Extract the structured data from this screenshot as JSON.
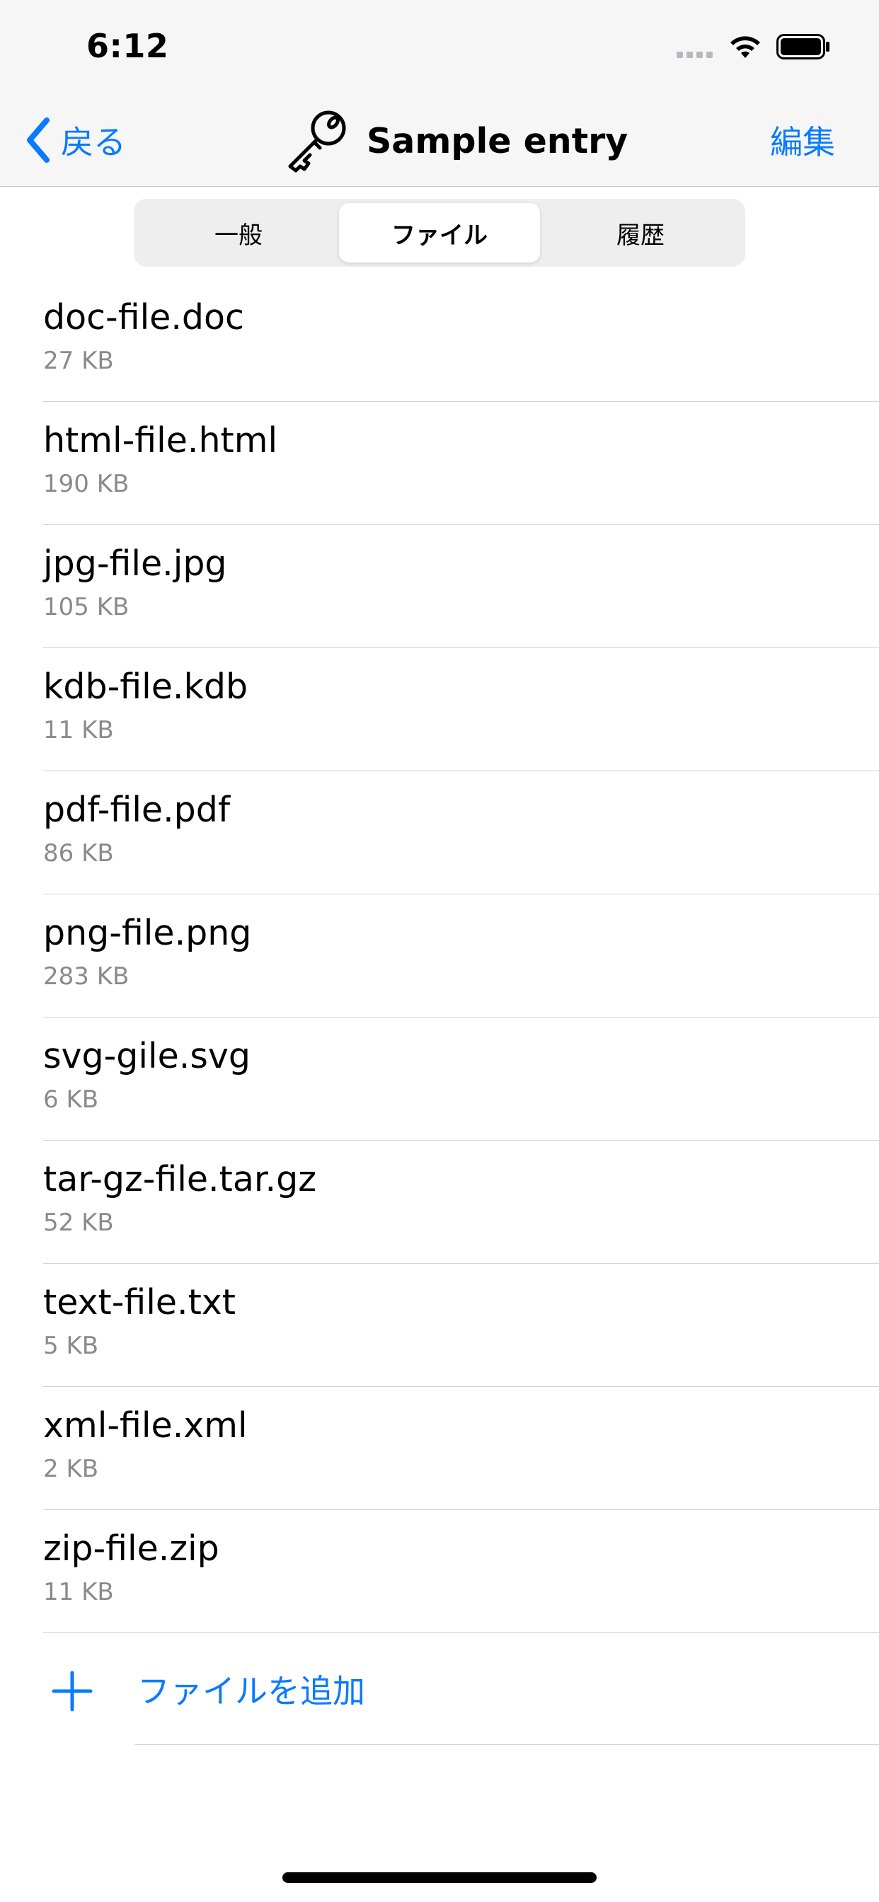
{
  "status_bar": {
    "time": "6:12"
  },
  "nav": {
    "back_label": "戻る",
    "title": "Sample entry",
    "edit_label": "編集"
  },
  "tabs": [
    {
      "label": "一般",
      "active": false
    },
    {
      "label": "ファイル",
      "active": true
    },
    {
      "label": "履歴",
      "active": false
    }
  ],
  "files": [
    {
      "name": "doc-file.doc",
      "size": "27 KB"
    },
    {
      "name": "html-file.html",
      "size": "190 KB"
    },
    {
      "name": "jpg-file.jpg",
      "size": "105 KB"
    },
    {
      "name": "kdb-file.kdb",
      "size": "11 KB"
    },
    {
      "name": "pdf-file.pdf",
      "size": "86 KB"
    },
    {
      "name": "png-file.png",
      "size": "283 KB"
    },
    {
      "name": "svg-gile.svg",
      "size": "6 KB"
    },
    {
      "name": "tar-gz-file.tar.gz",
      "size": "52 KB"
    },
    {
      "name": "text-file.txt",
      "size": "5 KB"
    },
    {
      "name": "xml-file.xml",
      "size": "2 KB"
    },
    {
      "name": "zip-file.zip",
      "size": "11 KB"
    }
  ],
  "add_file_label": "ファイルを追加",
  "colors": {
    "accent": "#0a7aff",
    "secondary_text": "#8a8a8e",
    "separator": "#d4d4d8"
  }
}
